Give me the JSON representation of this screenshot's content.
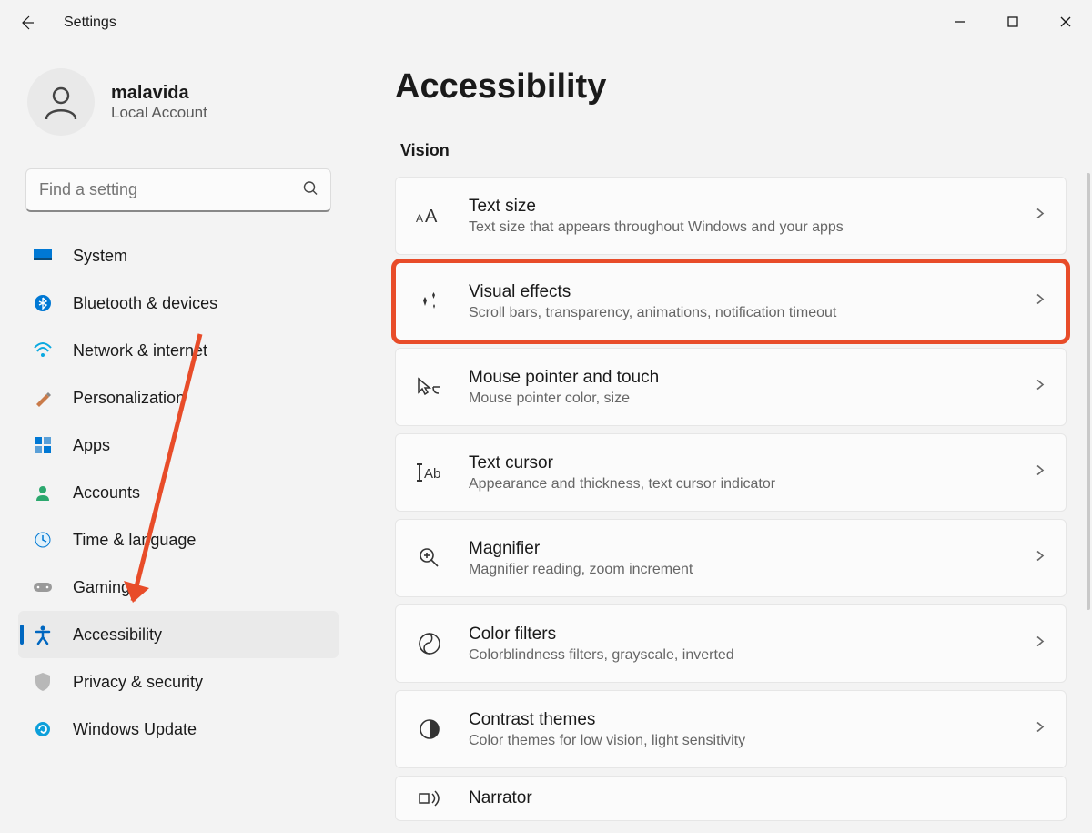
{
  "titlebar": {
    "title": "Settings"
  },
  "user": {
    "name": "malavida",
    "account_type": "Local Account"
  },
  "search": {
    "placeholder": "Find a setting"
  },
  "nav": {
    "items": [
      {
        "label": "System"
      },
      {
        "label": "Bluetooth & devices"
      },
      {
        "label": "Network & internet"
      },
      {
        "label": "Personalization"
      },
      {
        "label": "Apps"
      },
      {
        "label": "Accounts"
      },
      {
        "label": "Time & language"
      },
      {
        "label": "Gaming"
      },
      {
        "label": "Accessibility"
      },
      {
        "label": "Privacy & security"
      },
      {
        "label": "Windows Update"
      }
    ],
    "selected_index": 8
  },
  "page": {
    "heading": "Accessibility",
    "section": "Vision",
    "cards": [
      {
        "title": "Text size",
        "desc": "Text size that appears throughout Windows and your apps"
      },
      {
        "title": "Visual effects",
        "desc": "Scroll bars, transparency, animations, notification timeout",
        "highlighted": true
      },
      {
        "title": "Mouse pointer and touch",
        "desc": "Mouse pointer color, size"
      },
      {
        "title": "Text cursor",
        "desc": "Appearance and thickness, text cursor indicator"
      },
      {
        "title": "Magnifier",
        "desc": "Magnifier reading, zoom increment"
      },
      {
        "title": "Color filters",
        "desc": "Colorblindness filters, grayscale, inverted"
      },
      {
        "title": "Contrast themes",
        "desc": "Color themes for low vision, light sensitivity"
      },
      {
        "title": "Narrator",
        "desc": ""
      }
    ]
  },
  "annotation": {
    "color": "#e84c29"
  }
}
